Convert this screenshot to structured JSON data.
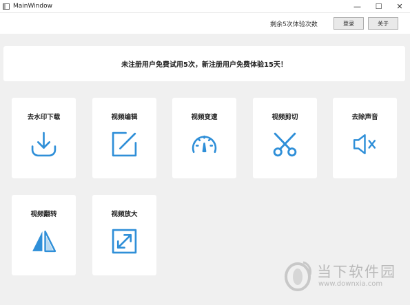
{
  "window": {
    "title": "MainWindow",
    "controls": {
      "minimize": "—",
      "maximize": "☐",
      "close": "✕"
    }
  },
  "topbar": {
    "remaining_text": "剩余5次体验次数",
    "login_label": "登录",
    "about_label": "关于"
  },
  "notice": {
    "text": "未注册用户免费试用5次，新注册用户免费体验15天！"
  },
  "tools": [
    {
      "label": "去水印下载",
      "icon": "download-icon"
    },
    {
      "label": "视频编辑",
      "icon": "edit-icon"
    },
    {
      "label": "视频变速",
      "icon": "speedometer-icon"
    },
    {
      "label": "视频剪切",
      "icon": "scissors-icon"
    },
    {
      "label": "去除声音",
      "icon": "mute-icon"
    },
    {
      "label": "视频翻转",
      "icon": "flip-icon"
    },
    {
      "label": "视频放大",
      "icon": "expand-icon"
    }
  ],
  "watermark": {
    "name": "当下软件园",
    "url": "www.downxia.com"
  },
  "colors": {
    "accent": "#2f8fd8",
    "background": "#f0f0f0",
    "card": "#ffffff"
  }
}
